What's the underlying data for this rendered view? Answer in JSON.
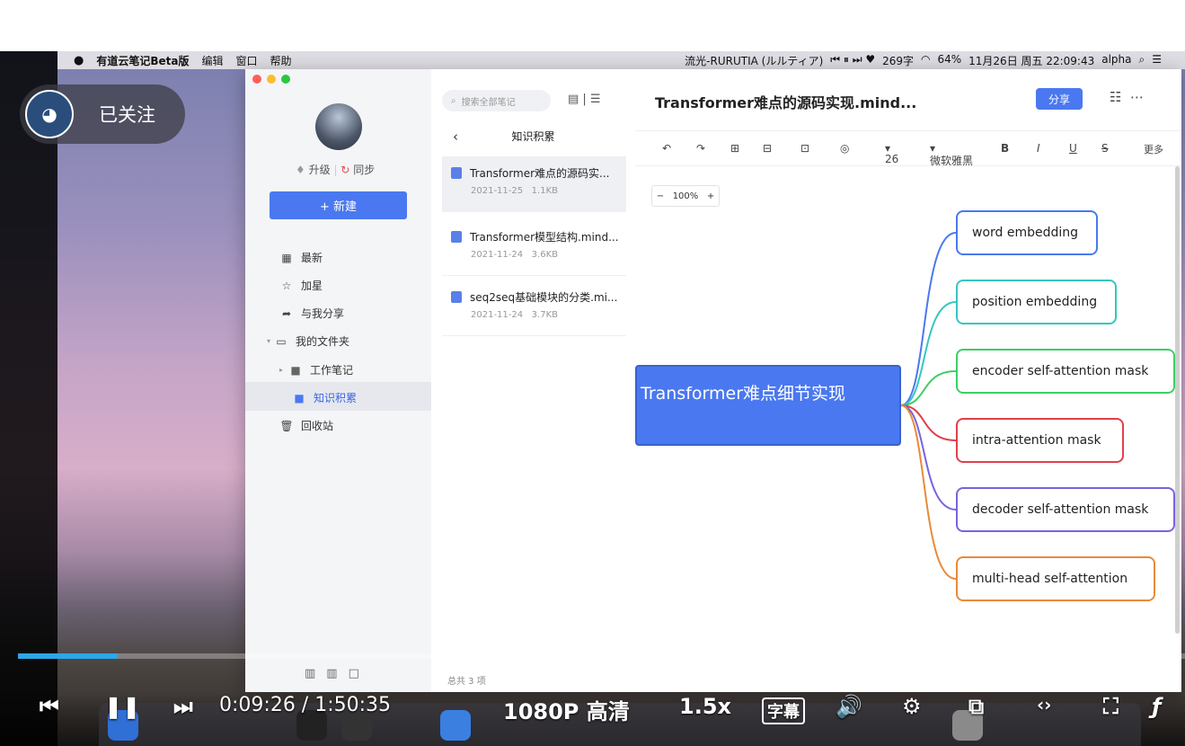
{
  "menubar": {
    "apple": "",
    "items": [
      "有道云笔记Beta版",
      "编辑",
      "窗口",
      "帮助"
    ],
    "now_playing": "流光-RURUTIA (ルルティア)",
    "status": "269字",
    "battery": "64%",
    "datetime": "11月26日 周五 22:09:43",
    "user": "alpha"
  },
  "follow": {
    "label": "已关注"
  },
  "sidebar": {
    "upgrade": "升级",
    "sync": "同步",
    "new_button": "+ 新建",
    "nav": [
      {
        "icon": "grid-icon",
        "label": "最新"
      },
      {
        "icon": "star-icon",
        "label": "加星"
      },
      {
        "icon": "share-icon",
        "label": "与我分享"
      },
      {
        "icon": "folder-icon",
        "label": "我的文件夹"
      },
      {
        "icon": "folder-icon",
        "label": "工作笔记"
      },
      {
        "icon": "folder-icon",
        "label": "知识积累"
      },
      {
        "icon": "trash-icon",
        "label": "回收站"
      }
    ],
    "selected": "知识积累"
  },
  "list": {
    "search_placeholder": "搜索全部笔记",
    "header": "知识积累",
    "notes": [
      {
        "title": "Transformer难点的源码实...",
        "date": "2021-11-25",
        "size": "1.1KB"
      },
      {
        "title": "Transformer模型结构.mind...",
        "date": "2021-11-24",
        "size": "3.6KB"
      },
      {
        "title": "seq2seq基础模块的分类.mi...",
        "date": "2021-11-24",
        "size": "3.7KB"
      }
    ],
    "total": "总共 3 项"
  },
  "editor": {
    "title": "Transformer难点的源码实现.mind...",
    "share": "分享",
    "font_size": "26",
    "font_name": "微软雅黑",
    "more": "更多",
    "zoom": "100%",
    "root": "Transformer难点细节实现",
    "children": [
      {
        "label": "word embedding",
        "color": "#4a78f0"
      },
      {
        "label": "position embedding",
        "color": "#34c6c0"
      },
      {
        "label": "encoder self-attention mask",
        "color": "#3dce67"
      },
      {
        "label": "intra-attention mask",
        "color": "#e0404a"
      },
      {
        "label": "decoder self-attention mask",
        "color": "#7a62e0"
      },
      {
        "label": "multi-head self-attention",
        "color": "#e88a3a"
      }
    ]
  },
  "player": {
    "time": "0:09:26 / 1:50:35",
    "quality": "1080P 高清",
    "speed": "1.5x",
    "subtitle": "字幕",
    "progress": 0.085
  }
}
